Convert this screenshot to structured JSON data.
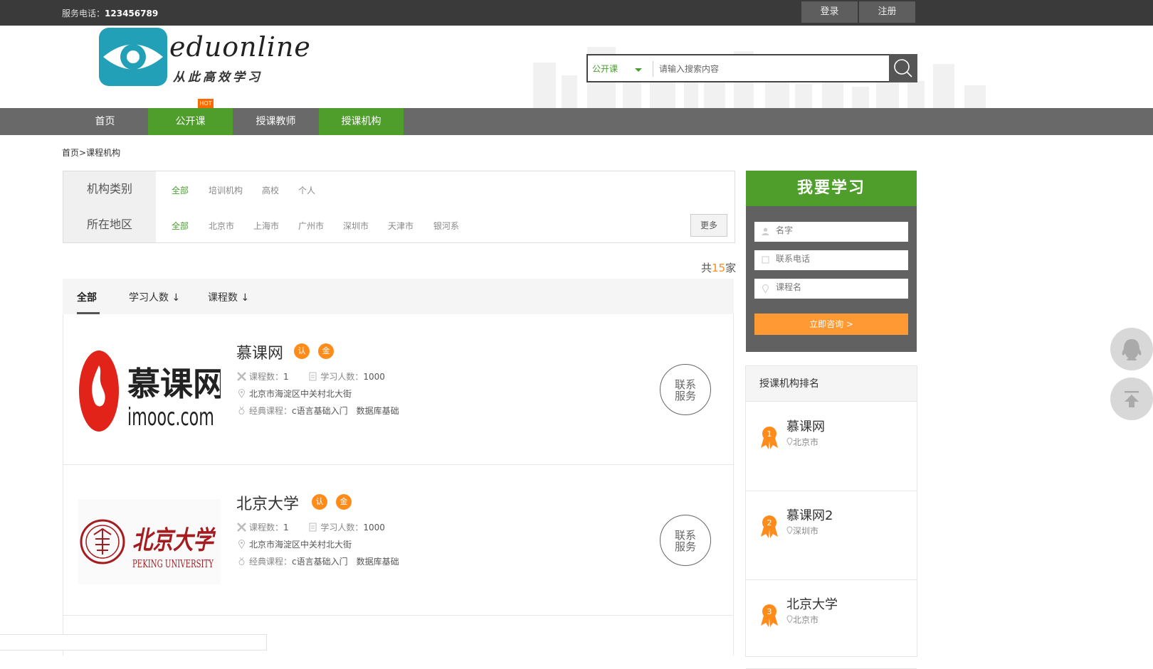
{
  "topbar": {
    "phone_label": "服务电话：",
    "phone_number": "123456789",
    "login": "登录",
    "register": "注册"
  },
  "brand": {
    "name": "eduonline",
    "slogan": "从此高效学习"
  },
  "search": {
    "category": "公开课",
    "placeholder": "请输入搜索内容"
  },
  "nav": {
    "items": [
      "首页",
      "公开课",
      "授课教师",
      "授课机构"
    ],
    "hot_badge": "HOT"
  },
  "breadcrumb": {
    "home": "首页",
    "sep": ">",
    "current": "课程机构"
  },
  "filter": {
    "type_label": "机构类别",
    "type_options": [
      "全部",
      "培训机构",
      "高校",
      "个人"
    ],
    "region_label": "所在地区",
    "region_options": [
      "全部",
      "北京市",
      "上海市",
      "广州市",
      "深圳市",
      "天津市",
      "银河系"
    ],
    "more": "更多"
  },
  "count": {
    "prefix": "共",
    "number": "15",
    "suffix": "家"
  },
  "sort_tabs": [
    "全部",
    "学习人数 ↓",
    "课程数 ↓"
  ],
  "orgs": [
    {
      "name": "慕课网",
      "badge_cert": "认",
      "badge_gold": "金",
      "courses_label": "课程数：",
      "courses": "1",
      "students_label": "学习人数：",
      "students": "1000",
      "address": "北京市海淀区中关村北大街",
      "classic_label": "经典课程：",
      "classic1": "c语言基础入门",
      "classic2": "数据库基础",
      "logo_text": "慕课网",
      "logo_domain": "imooc.com",
      "contact": "联系服务"
    },
    {
      "name": "北京大学",
      "badge_cert": "认",
      "badge_gold": "金",
      "courses_label": "课程数：",
      "courses": "1",
      "students_label": "学习人数：",
      "students": "1000",
      "address": "北京市海淀区中关村北大街",
      "classic_label": "经典课程：",
      "classic1": "c语言基础入门",
      "classic2": "数据库基础",
      "logo_text": "北京大学",
      "logo_domain": "PEKING UNIVERSITY",
      "contact": "联系服务"
    }
  ],
  "study_form": {
    "title": "我要学习",
    "name_placeholder": "名字",
    "phone_placeholder": "联系电话",
    "course_placeholder": "课程名",
    "submit": "立即咨询 >"
  },
  "ranking": {
    "title": "授课机构排名",
    "items": [
      {
        "rank": "1",
        "name": "慕课网",
        "city": "北京市"
      },
      {
        "rank": "2",
        "name": "慕课网2",
        "city": "深圳市"
      },
      {
        "rank": "3",
        "name": "北京大学",
        "city": "北京市"
      }
    ]
  },
  "colors": {
    "green": "#4f9e2c",
    "orange": "#ff8c1a",
    "dark": "#3a3a3a",
    "nav": "#696969"
  }
}
